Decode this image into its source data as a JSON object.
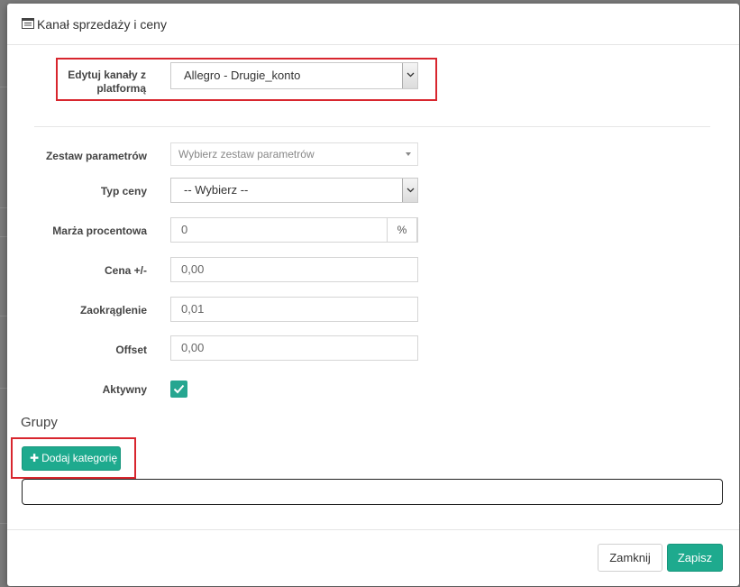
{
  "modal": {
    "title": "Kanał sprzedaży i ceny",
    "title_icon": "list-box-icon"
  },
  "form": {
    "platform_label": "Edytuj kanały z platformą",
    "platform_value": "Allegro - Drugie_konto",
    "param_set_label": "Zestaw parametrów",
    "param_set_placeholder": "Wybierz zestaw parametrów",
    "price_type_label": "Typ ceny",
    "price_type_value": "-- Wybierz --",
    "margin_label": "Marża procentowa",
    "margin_value": "0",
    "margin_unit": "%",
    "price_adj_label": "Cena +/-",
    "price_adj_value": "0,00",
    "rounding_label": "Zaokrąglenie",
    "rounding_value": "0,01",
    "offset_label": "Offset",
    "offset_value": "0,00",
    "active_label": "Aktywny",
    "active_checked": true
  },
  "groups": {
    "title": "Grupy",
    "add_button_label": "Dodaj kategorię"
  },
  "footer": {
    "close_label": "Zamknij",
    "save_label": "Zapisz"
  },
  "colors": {
    "accent": "#1eaa8e",
    "highlight": "#d8262e"
  }
}
